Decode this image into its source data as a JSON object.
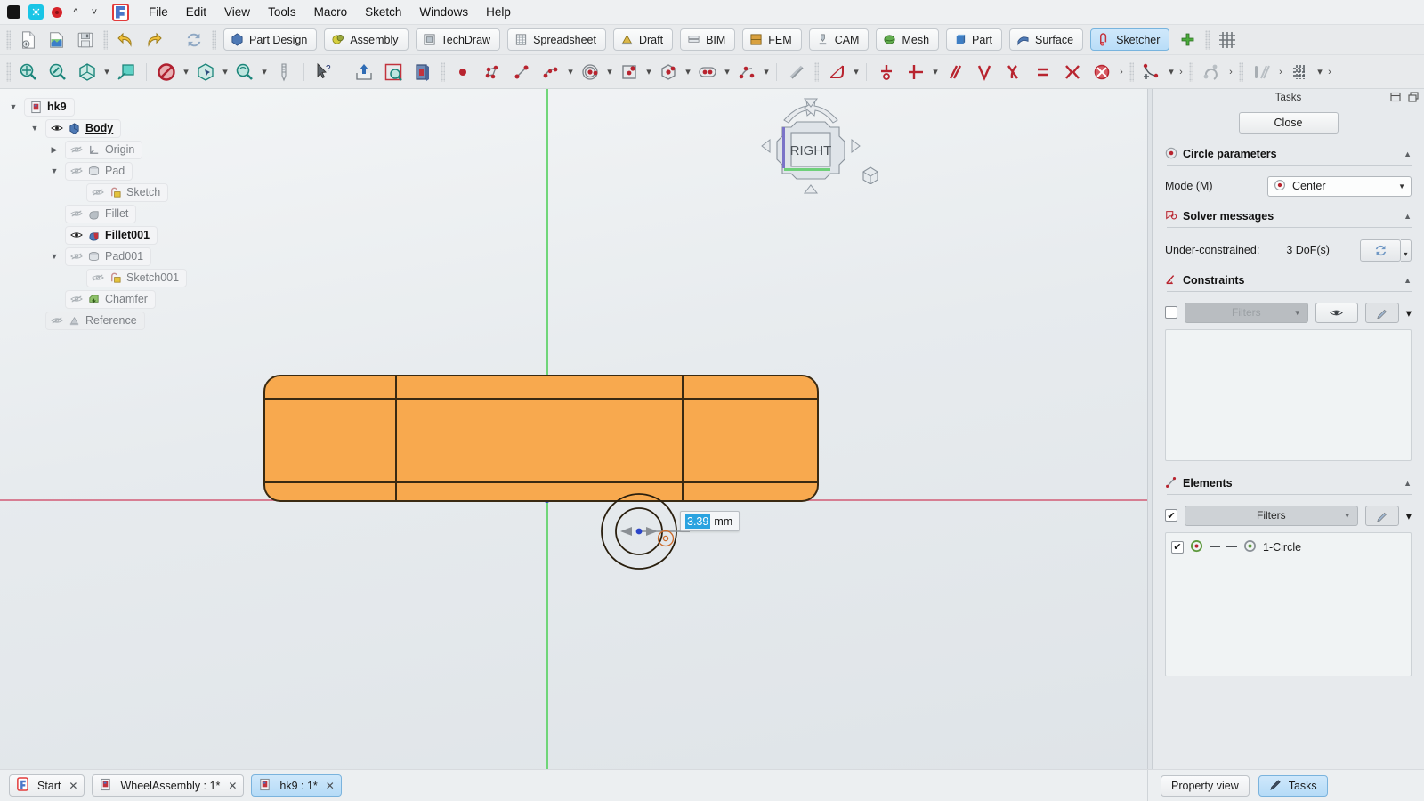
{
  "window": {
    "traffic": [
      "black-square",
      "app-badge",
      "record-dot",
      "chevron-up",
      "chevron-down"
    ],
    "logo": "freecad-logo"
  },
  "menu": {
    "items": [
      "File",
      "Edit",
      "View",
      "Tools",
      "Macro",
      "Sketch",
      "Windows",
      "Help"
    ]
  },
  "toolbar_file": {
    "buttons": [
      {
        "name": "new-document-icon",
        "title": "New"
      },
      {
        "name": "open-document-icon",
        "title": "Open"
      },
      {
        "name": "save-document-icon",
        "title": "Save"
      },
      {
        "name": "undo-icon",
        "title": "Undo"
      },
      {
        "name": "redo-icon",
        "title": "Redo"
      },
      {
        "name": "refresh-icon",
        "title": "Refresh"
      }
    ]
  },
  "workbenches": {
    "items": [
      {
        "label": "Part Design",
        "icon": "part-design-icon",
        "active": false
      },
      {
        "label": "Assembly",
        "icon": "assembly-icon",
        "active": false
      },
      {
        "label": "TechDraw",
        "icon": "techdraw-icon",
        "active": false
      },
      {
        "label": "Spreadsheet",
        "icon": "spreadsheet-icon",
        "active": false
      },
      {
        "label": "Draft",
        "icon": "draft-icon",
        "active": false
      },
      {
        "label": "BIM",
        "icon": "bim-icon",
        "active": false
      },
      {
        "label": "FEM",
        "icon": "fem-icon",
        "active": false
      },
      {
        "label": "CAM",
        "icon": "cam-icon",
        "active": false
      },
      {
        "label": "Mesh",
        "icon": "mesh-icon",
        "active": false
      },
      {
        "label": "Part",
        "icon": "part-icon",
        "active": false
      },
      {
        "label": "Surface",
        "icon": "surface-icon",
        "active": false
      },
      {
        "label": "Sketcher",
        "icon": "sketcher-icon",
        "active": true
      }
    ],
    "add_label": "add-workbench-icon",
    "grid_label": "grid-icon"
  },
  "sketcher_toolbar": {
    "view_group": [
      "fit-all-icon",
      "zoom-selection-icon",
      "axonometric-view-icon",
      "view-section-icon",
      "stop-operation-icon",
      "box-selection-icon",
      "zoom-box-icon",
      "measure-icon",
      "whats-this-icon",
      "leave-sketch-icon",
      "view-sketch-icon",
      "view-section-sketch-icon"
    ],
    "geometry_group": [
      "point-icon",
      "polyline-icon",
      "line-icon",
      "arc-icon",
      "circle-icon",
      "rectangle-icon",
      "polygon-icon",
      "slot-icon",
      "bspline-icon",
      "construction-geometry-icon",
      "fillet-icon"
    ],
    "constraint_group": [
      "constrain-coincident-icon",
      "constrain-distance-icon",
      "constrain-parallel-icon",
      "constrain-perpendicular-icon",
      "constrain-tangent-icon",
      "constrain-equal-icon",
      "constrain-symmetric-icon",
      "constrain-block-icon",
      "toggle-driving-icon",
      "sketcher-tools-icon",
      "sketcher-bspline-icon",
      "sketcher-visual-icon",
      "sketcher-grid-icon"
    ]
  },
  "tree": {
    "nodes": [
      {
        "label": "hk9",
        "indent": 0,
        "arrow": "down",
        "eye": "none",
        "icon": "document-icon",
        "state": "bold"
      },
      {
        "label": "Body",
        "indent": 1,
        "arrow": "down",
        "eye": "open",
        "icon": "body-icon",
        "state": "selected"
      },
      {
        "label": "Origin",
        "indent": 2,
        "arrow": "right",
        "eye": "closed",
        "icon": "origin-icon",
        "state": "dim"
      },
      {
        "label": "Pad",
        "indent": 2,
        "arrow": "down",
        "eye": "closed",
        "icon": "pad-icon",
        "state": "dim"
      },
      {
        "label": "Sketch",
        "indent": 3,
        "arrow": "none",
        "eye": "closed",
        "icon": "sketch-icon",
        "state": "dim"
      },
      {
        "label": "Fillet",
        "indent": 2,
        "arrow": "none",
        "eye": "closed",
        "icon": "fillet-icon",
        "state": "dim"
      },
      {
        "label": "Fillet001",
        "indent": 2,
        "arrow": "none",
        "eye": "open",
        "icon": "fillet-active-icon",
        "state": "bold"
      },
      {
        "label": "Pad001",
        "indent": 2,
        "arrow": "down",
        "eye": "closed",
        "icon": "pad-icon",
        "state": "dim"
      },
      {
        "label": "Sketch001",
        "indent": 3,
        "arrow": "none",
        "eye": "closed",
        "icon": "sketch-icon",
        "state": "dim"
      },
      {
        "label": "Chamfer",
        "indent": 2,
        "arrow": "none",
        "eye": "closed",
        "icon": "chamfer-icon",
        "state": "dim"
      },
      {
        "label": "Reference",
        "indent": 1,
        "arrow": "none",
        "eye": "closed",
        "icon": "reference-icon",
        "state": "dim"
      }
    ]
  },
  "viewport": {
    "navigation_cube_face": "RIGHT",
    "dimension_input": {
      "value": "3.39",
      "unit": "mm",
      "selected": true
    }
  },
  "tasks": {
    "title": "Tasks",
    "close_label": "Close",
    "circle_parameters": {
      "title": "Circle parameters",
      "mode_label": "Mode (M)",
      "mode_value": "Center"
    },
    "solver": {
      "title": "Solver messages",
      "status_label": "Under-constrained:",
      "status_value": "3 DoF(s)"
    },
    "constraints": {
      "title": "Constraints",
      "filter_placeholder": "Filters"
    },
    "elements": {
      "title": "Elements",
      "filter_label": "Filters",
      "items": [
        {
          "label": "1-Circle",
          "checked": true
        }
      ]
    }
  },
  "statusbar": {
    "document_tabs": [
      {
        "label": "Start",
        "icon": "freecad-start-icon",
        "active": false
      },
      {
        "label": "WheelAssembly : 1*",
        "icon": "document-icon",
        "active": false
      },
      {
        "label": "hk9 : 1*",
        "icon": "document-icon",
        "active": true
      }
    ],
    "panel_buttons": [
      {
        "label": "Property view",
        "active": false
      },
      {
        "label": "Tasks",
        "active": true
      }
    ]
  },
  "colors": {
    "accent_blue": "#b5dbf7",
    "part_orange": "#f8a94e",
    "part_edge": "#5a3b17",
    "x_axis": "#d36b82",
    "y_axis": "#62d36b",
    "selection_blue": "#2aa3e0"
  }
}
